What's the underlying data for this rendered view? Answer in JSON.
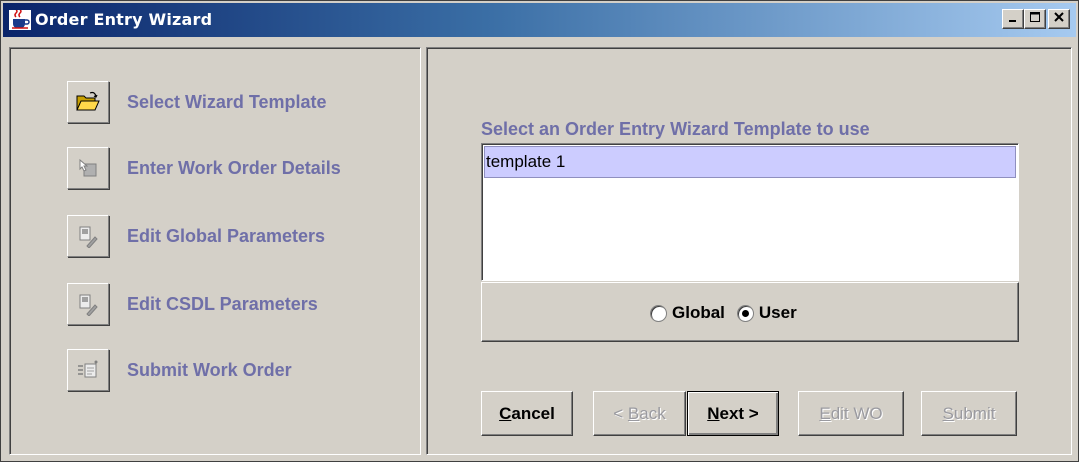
{
  "window": {
    "title": "Order Entry Wizard",
    "controls": {
      "minimize_icon": "minimize-icon",
      "maximize_icon": "maximize-icon",
      "close_icon": "close-icon"
    }
  },
  "steps": [
    {
      "label": "Select Wizard Template",
      "icon": "folder-open-icon",
      "active": true
    },
    {
      "label": "Enter Work Order Details",
      "icon": "cursor-hand-icon",
      "active": false
    },
    {
      "label": "Edit Global Parameters",
      "icon": "edit-document-icon",
      "active": false
    },
    {
      "label": "Edit CSDL Parameters",
      "icon": "edit-document-icon",
      "active": false
    },
    {
      "label": "Submit Work Order",
      "icon": "submit-icon",
      "active": false
    }
  ],
  "main": {
    "prompt": "Select an Order Entry Wizard Template to use",
    "templates": [
      "template 1"
    ],
    "selected_template": "template 1",
    "scope": {
      "options": [
        "Global",
        "User"
      ],
      "selected": "User"
    }
  },
  "buttons": {
    "cancel": {
      "mnemonic": "C",
      "rest": "ancel",
      "enabled": true
    },
    "back": {
      "prefix": "< ",
      "mnemonic": "B",
      "rest": "ack",
      "enabled": false
    },
    "next": {
      "mnemonic": "N",
      "rest": "ext >",
      "enabled": true
    },
    "edit_wo": {
      "mnemonic": "E",
      "rest": "dit WO",
      "enabled": false
    },
    "submit": {
      "mnemonic": "S",
      "rest": "ubmit",
      "enabled": false
    }
  },
  "colors": {
    "step_text": "#6f6fa8",
    "selection": "#ccccff",
    "face": "#d4d0c8",
    "title_gradient_start": "#0a246a",
    "title_gradient_end": "#a6caf0"
  }
}
